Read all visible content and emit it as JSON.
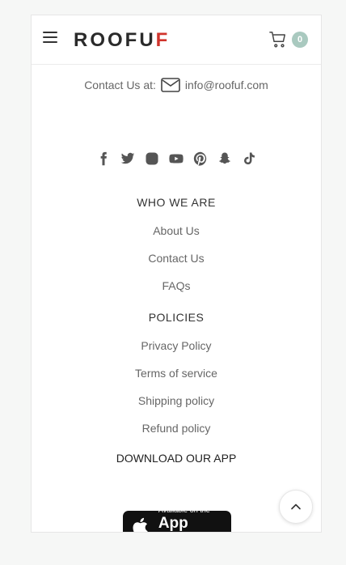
{
  "header": {
    "logo_main": "ROOFU",
    "logo_accent": "F",
    "cart_count": "0"
  },
  "contact": {
    "label": "Contact Us at:",
    "email": "info@roofuf.com"
  },
  "social": {
    "icons": [
      "facebook-icon",
      "twitter-icon",
      "instagram-icon",
      "youtube-icon",
      "pinterest-icon",
      "snapchat-icon",
      "tiktok-icon"
    ]
  },
  "who_we_are": {
    "title": "WHO WE ARE",
    "links": [
      "About Us",
      "Contact Us",
      "FAQs"
    ]
  },
  "policies": {
    "title": "POLICIES",
    "links": [
      "Privacy Policy",
      "Terms of service",
      "Shipping policy",
      "Refund policy"
    ]
  },
  "app": {
    "title": "DOWNLOAD OUR APP",
    "badge_small": "Available on the",
    "badge_big": "App Store"
  },
  "colors": {
    "cart_badge": "#a9c9bf",
    "logo_accent": "#d0342c"
  }
}
